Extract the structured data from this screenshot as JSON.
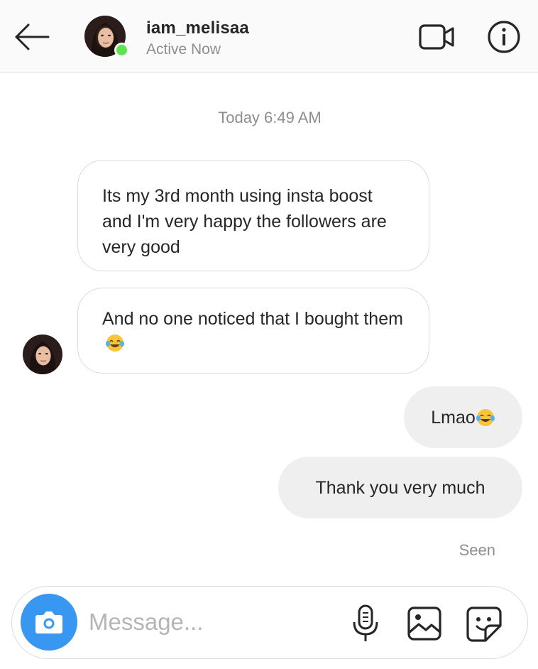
{
  "header": {
    "username": "iam_melisaa",
    "status": "Active Now"
  },
  "conversation": {
    "timestamp": "Today 6:49 AM",
    "messages": [
      {
        "from": "them",
        "text": "Its my 3rd month using insta boost and I'm very happy the followers are very good"
      },
      {
        "from": "them",
        "text": "And no one noticed that I bought them",
        "emoji": "face-with-tears-of-joy"
      },
      {
        "from": "me",
        "text": "Lmao",
        "emoji": "face-with-tears-of-joy"
      },
      {
        "from": "me",
        "text": "Thank you very much"
      }
    ],
    "seen_label": "Seen"
  },
  "composer": {
    "placeholder": "Message..."
  },
  "colors": {
    "online": "#5ce450",
    "camera_button": "#3897f0",
    "outgoing_bubble": "#efefef",
    "incoming_border": "#dbdbdb",
    "muted_text": "#8e8e8e"
  },
  "icons": [
    "back-arrow-icon",
    "video-call-icon",
    "info-icon",
    "camera-icon",
    "microphone-icon",
    "gallery-icon",
    "sticker-icon",
    "face-with-tears-of-joy-emoji"
  ]
}
